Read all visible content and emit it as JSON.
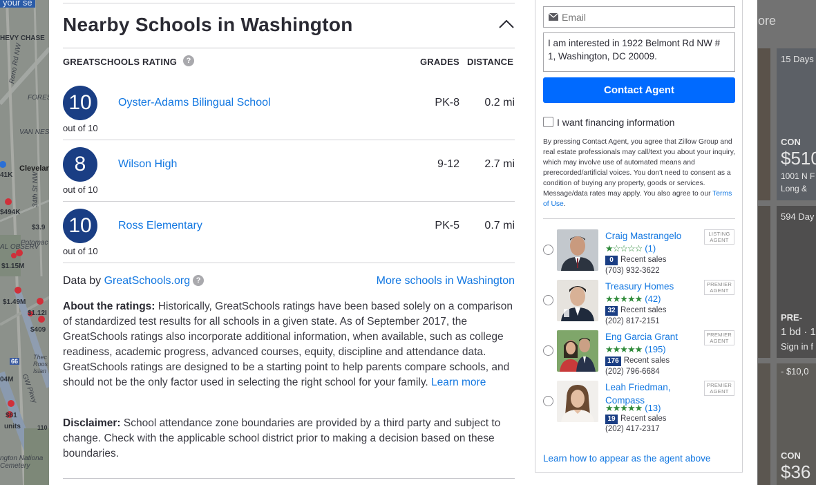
{
  "colors": {
    "link": "#1277e1",
    "rating_circle": "#1a3e84",
    "contact_button": "#006aff",
    "star_green": "#2f8a3a"
  },
  "map": {
    "labels": [
      "HEVY CHASE",
      "Reno Rd NW",
      "FORES",
      "VAN NES",
      "Clevelar",
      "34th St NW",
      "41K",
      "$494K",
      "$3.9",
      "OTOMAC",
      "Potomac",
      "AL OBSERV",
      "$1.15M",
      "$1.49M",
      "$1.12I",
      "$409",
      "Thec Roos Islan",
      "GW Pkwy",
      "04M",
      "$61",
      "units",
      "ngton Nationa Cemetery",
      "110",
      "66"
    ]
  },
  "background_listings": {
    "top_text": "ore",
    "header_text": "your se",
    "card1": {
      "days": "15 Days",
      "status": "CON",
      "price": "$510",
      "address": "1001 N F",
      "sub": "Long &"
    },
    "card2": {
      "days": "594 Day",
      "status": "PRE-",
      "beds": "1 bd · 1",
      "sub": "Sign in f"
    },
    "card3": {
      "price": "- $10,0",
      "status": "CON",
      "price2": "$36"
    }
  },
  "schools_section": {
    "title": "Nearby Schools in Washington",
    "col_rating": "GREATSCHOOLS RATING",
    "col_grades": "GRADES",
    "col_distance": "DISTANCE",
    "schools": [
      {
        "rating": "10",
        "out_of": "out of 10",
        "name": "Oyster-Adams Bilingual School",
        "grades": "PK-8",
        "distance": "0.2 mi"
      },
      {
        "rating": "8",
        "out_of": "out of 10",
        "name": "Wilson High",
        "grades": "9-12",
        "distance": "2.7 mi"
      },
      {
        "rating": "10",
        "out_of": "out of 10",
        "name": "Ross Elementary",
        "grades": "PK-5",
        "distance": "0.7 mi"
      }
    ],
    "data_by_prefix": "Data by ",
    "data_by_link": "GreatSchools.org",
    "more_schools": "More schools in Washington",
    "about_heading": "About the ratings:",
    "about_text": " Historically, GreatSchools ratings have been based solely on a comparison of standardized test results for all schools in a given state. As of September 2017, the GreatSchools ratings also incorporate additional information, when available, such as college readiness, academic progress, advanced courses, equity, discipline and attendance data. GreatSchools ratings are designed to be a starting point to help parents compare schools, and should not be the only factor used in selecting the right school for your family. ",
    "learn_more": "Learn more",
    "disclaimer_heading": "Disclaimer:",
    "disclaimer_text": " School attendance zone boundaries are provided by a third party and subject to change. Check with the applicable school district prior to making a decision based on these boundaries."
  },
  "contact_form": {
    "email_placeholder": "Email",
    "message": "I am interested in 1922 Belmont Rd NW # 1, Washington, DC 20009.",
    "contact_button": "Contact Agent",
    "financing_label": "I want financing information",
    "legal_text": "By pressing Contact Agent, you agree that Zillow Group and real estate professionals may call/text you about your inquiry, which may involve use of automated means and prerecorded/artificial voices. You don't need to consent as a condition of buying any property, goods or services. Message/data rates may apply. You also agree to our ",
    "terms_link": "Terms of Use",
    "legal_end": ".",
    "agents": [
      {
        "name": "Craig Mastrangelo",
        "badge": "LISTING AGENT",
        "rating": 1,
        "stars_filled": "★",
        "stars_empty": "☆☆☆☆",
        "reviews": "(1)",
        "sales": "0",
        "sales_label": "Recent sales",
        "phone": "(703) 932-3622"
      },
      {
        "name": "Treasury Homes",
        "badge": "PREMIER AGENT",
        "rating": 5,
        "stars_filled": "★★★★★",
        "stars_empty": "",
        "reviews": "(42)",
        "sales": "32",
        "sales_label": "Recent sales",
        "phone": "(202) 817-2151"
      },
      {
        "name": "Eng Garcia Grant",
        "badge": "PREMIER AGENT",
        "rating": 5,
        "stars_filled": "★★★★★",
        "stars_empty": "",
        "reviews": "(195)",
        "sales": "176",
        "sales_label": "Recent sales",
        "phone": "(202) 796-6684"
      },
      {
        "name": "Leah Friedman, Compass",
        "badge": "PREMIER AGENT",
        "rating": 5,
        "stars_filled": "★★★★★",
        "stars_empty": "",
        "reviews": "(13)",
        "sales": "19",
        "sales_label": "Recent sales",
        "phone": "(202) 417-2317"
      }
    ],
    "learn_link": "Learn how to appear as the agent above"
  }
}
